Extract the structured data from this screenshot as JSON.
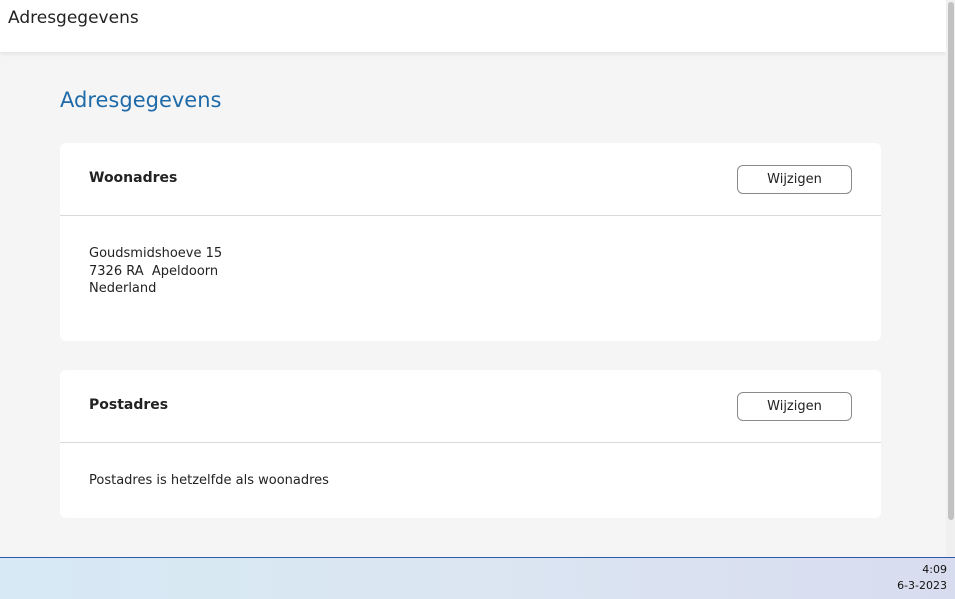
{
  "header": {
    "title": "Adresgegevens"
  },
  "main": {
    "page_title": "Adresgegevens"
  },
  "home_address": {
    "title": "Woonadres",
    "edit_label": "Wijzigen",
    "lines": [
      "Goudsmidshoeve 15",
      "7326 RA  Apeldoorn",
      "Nederland"
    ]
  },
  "postal_address": {
    "title": "Postadres",
    "edit_label": "Wijzigen",
    "text": "Postadres is hetzelfde als woonadres"
  },
  "taskbar": {
    "time": "4:09",
    "date": "6-3-2023"
  },
  "colors": {
    "accent": "#1f6aa8",
    "background": "#f5f5f5",
    "card": "#ffffff"
  }
}
